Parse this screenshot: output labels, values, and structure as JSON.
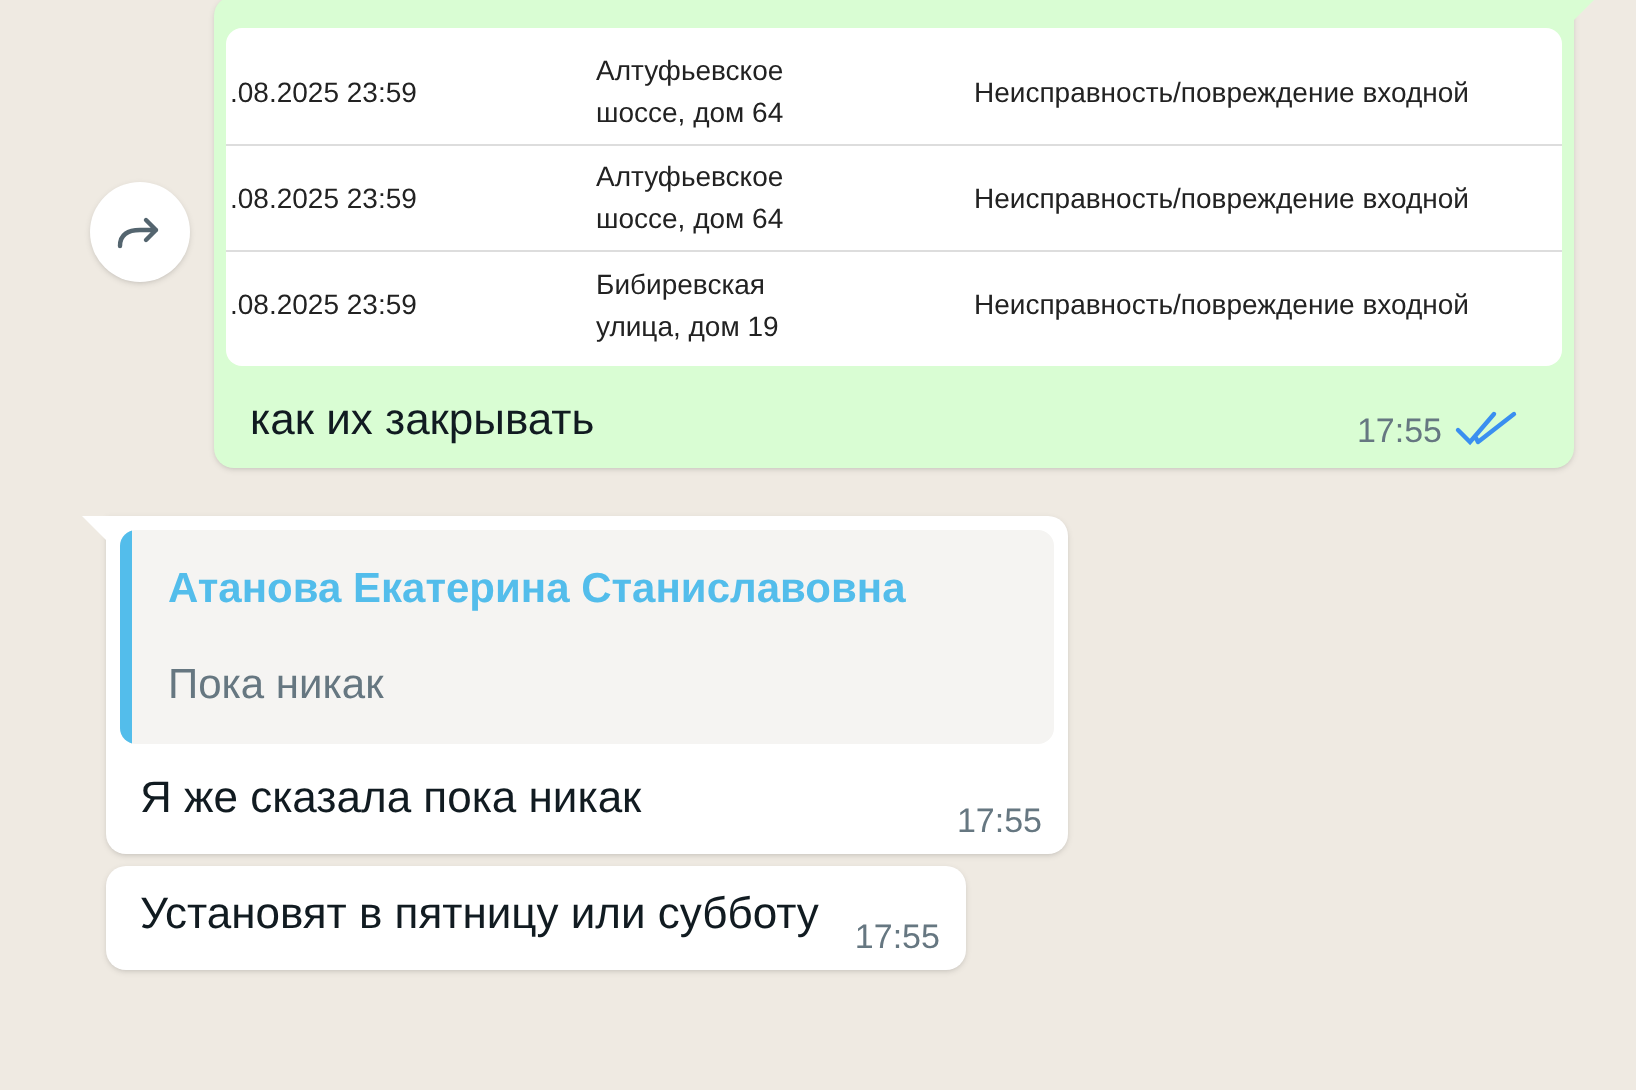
{
  "outgoing": {
    "table_rows": [
      {
        "date": ".08.2025 23:59",
        "address": "Алтуфьевское шоссе, дом 64",
        "issue": "Неисправность/повреждение входной"
      },
      {
        "date": ".08.2025 23:59",
        "address": "Алтуфьевское шоссе, дом 64",
        "issue": "Неисправность/повреждение входной"
      },
      {
        "date": ".08.2025 23:59",
        "address": "Бибиревская улица, дом 19",
        "issue": "Неисправность/повреждение входной"
      }
    ],
    "text": "как их закрывать",
    "time": "17:55",
    "read": true
  },
  "incoming": [
    {
      "quote": {
        "author": "Атанова Екатерина Станиславовна",
        "text": "Пока никак"
      },
      "text": "Я же сказала пока никак",
      "time": "17:55"
    },
    {
      "text": "Установят в пятницу или субботу",
      "time": "17:55"
    }
  ]
}
